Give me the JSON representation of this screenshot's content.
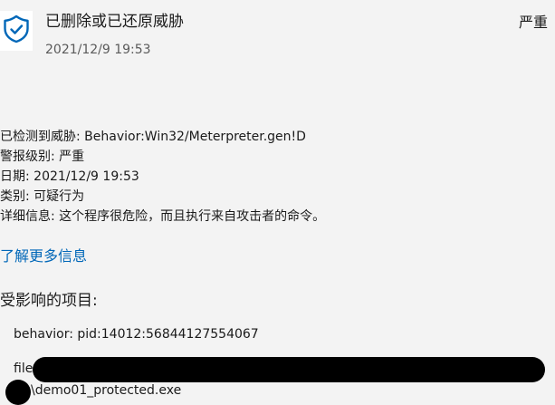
{
  "header": {
    "title": "已删除或已还原威胁",
    "timestamp": "2021/12/9 19:53",
    "severity": "严重"
  },
  "details": {
    "threat_label": "已检测到威胁:",
    "threat_value": "Behavior:Win32/Meterpreter.gen!D",
    "alert_level_label": "警报级别:",
    "alert_level_value": "严重",
    "date_label": "日期:",
    "date_value": "2021/12/9 19:53",
    "category_label": "类别:",
    "category_value": "可疑行为",
    "description_label": "详细信息:",
    "description_value": "这个程序很危险，而且执行来自攻击者的命令。"
  },
  "learn_more": "了解更多信息",
  "affected": {
    "heading": "受影响的项目:",
    "items": [
      "behavior: pid:14012:56844127554067",
      "file:",
      "\\demo01_protected.exe"
    ]
  },
  "colors": {
    "background": "#f3f3f3",
    "link": "#0067b8",
    "shield": "#0067b8",
    "redaction": "#000000"
  },
  "icons": {
    "status": "shield-check-icon"
  }
}
